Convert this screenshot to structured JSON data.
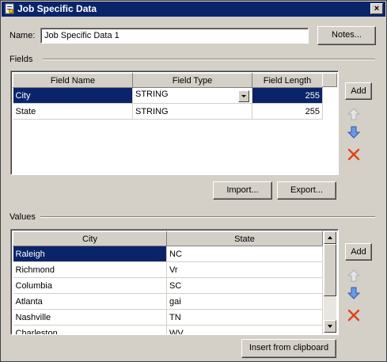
{
  "window": {
    "title": "Job Specific Data",
    "close_glyph": "×"
  },
  "name_label": "Name:",
  "name_value": "Job Specific Data 1",
  "notes_button": "Notes...",
  "fields": {
    "group_label": "Fields",
    "columns": [
      "Field Name",
      "Field Type",
      "Field Length"
    ],
    "rows": [
      {
        "name": "City",
        "type": "STRING",
        "length": "255"
      },
      {
        "name": "State",
        "type": "STRING",
        "length": "255"
      }
    ],
    "add_button": "Add",
    "import_button": "Import...",
    "export_button": "Export..."
  },
  "values": {
    "group_label": "Values",
    "columns": [
      "City",
      "State"
    ],
    "rows": [
      {
        "city": "Raleigh",
        "state": "NC"
      },
      {
        "city": "Richmond",
        "state": "Vr"
      },
      {
        "city": "Columbia",
        "state": "SC"
      },
      {
        "city": "Atlanta",
        "state": "gai"
      },
      {
        "city": "Nashville",
        "state": "TN"
      },
      {
        "city": "Charleston",
        "state": "WV"
      }
    ],
    "add_button": "Add",
    "insert_button": "Insert from clipboard"
  },
  "icons": {
    "move_up": "arrow-up-icon",
    "move_down": "arrow-down-icon",
    "delete": "delete-x-icon",
    "colors": {
      "arrow": "#3a6fc4",
      "arrow_disabled": "#c0c0c0",
      "delete": "#e0421a",
      "selection": "#0a246a"
    }
  }
}
